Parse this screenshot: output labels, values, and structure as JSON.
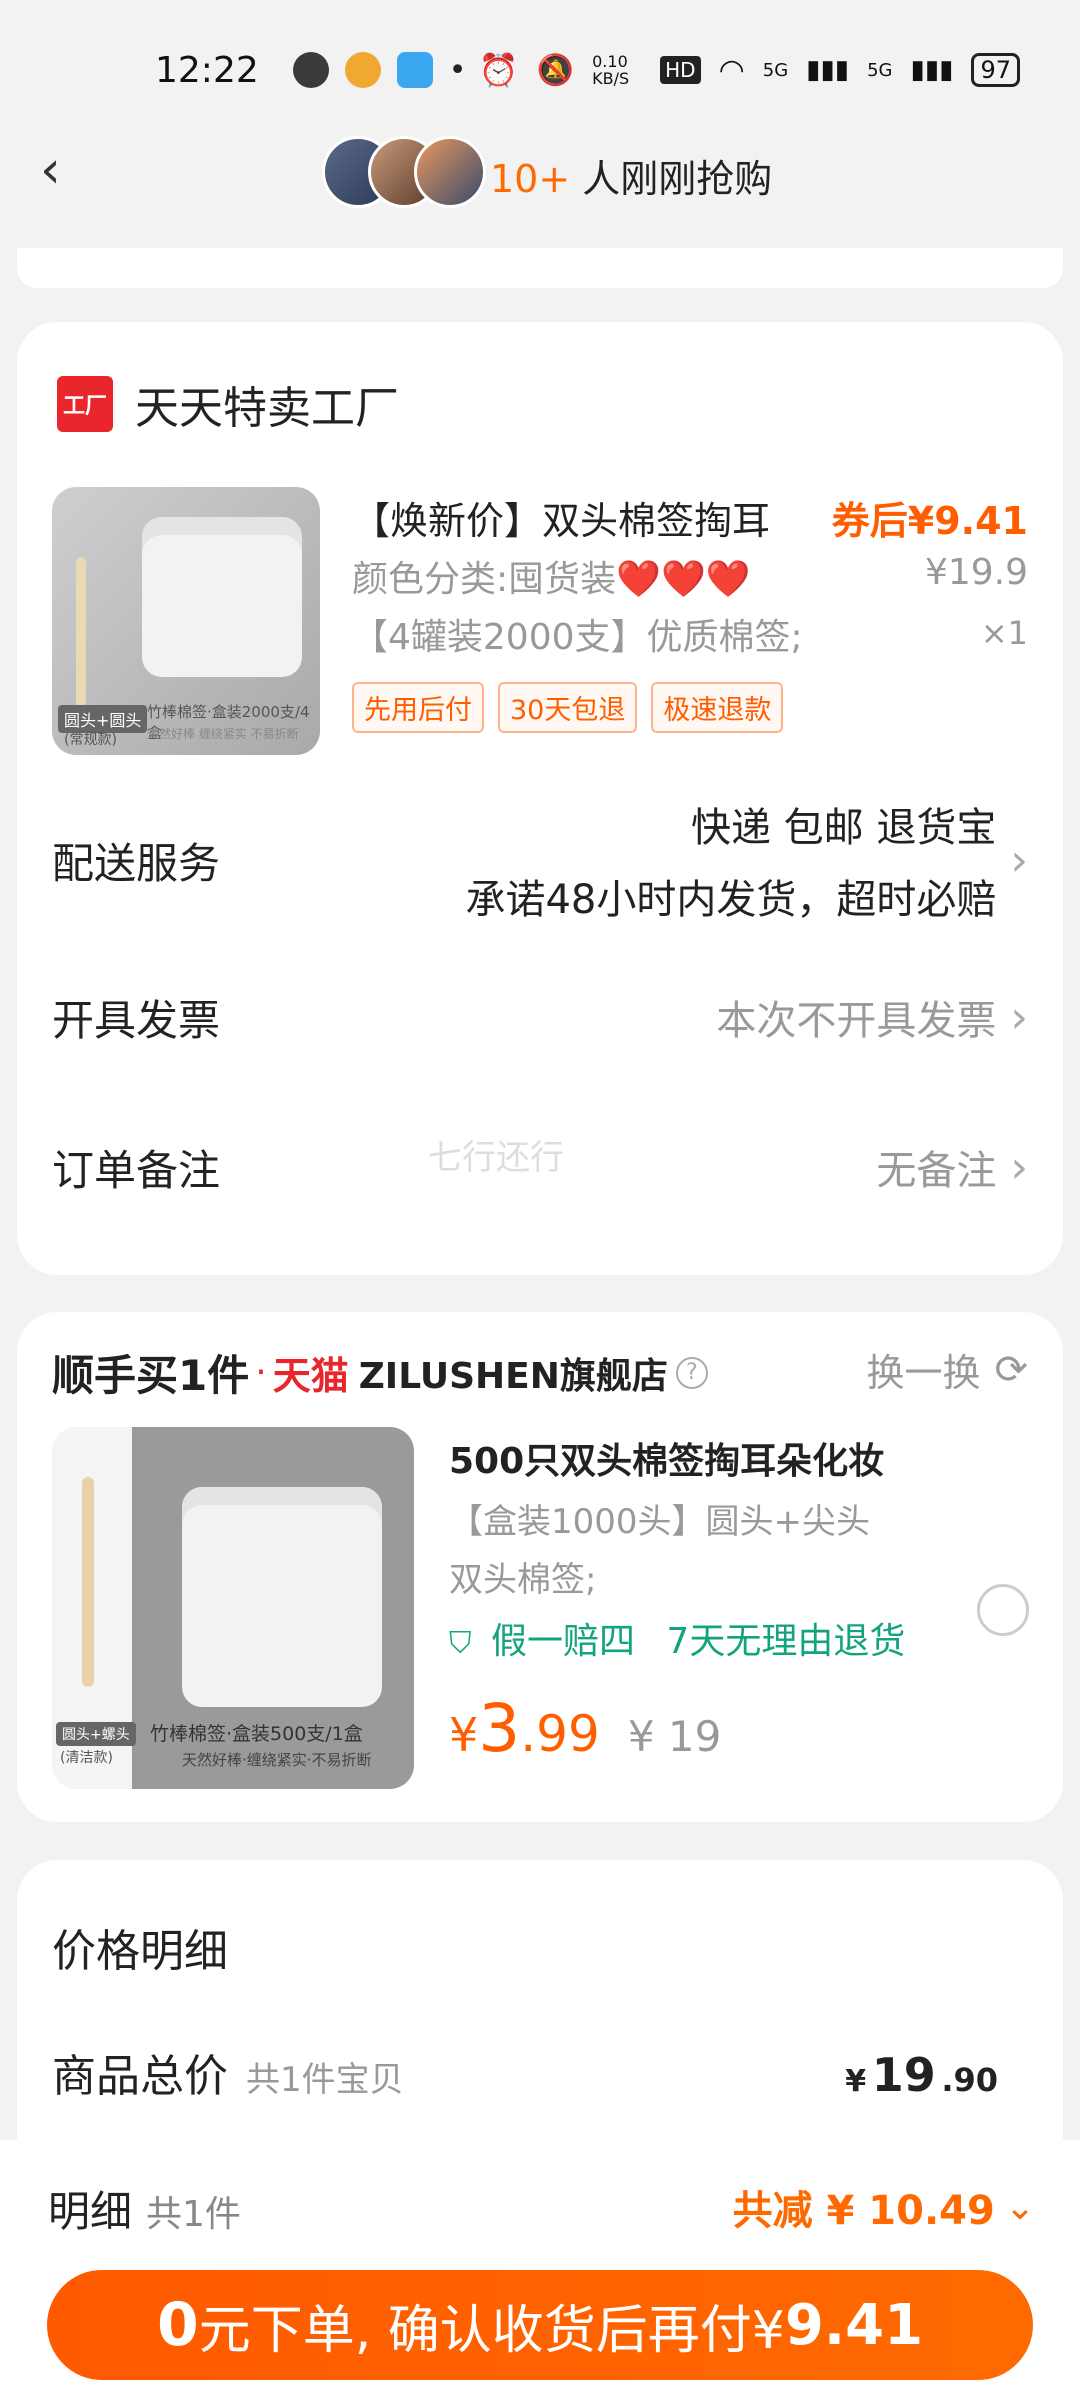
{
  "status_bar": {
    "time": "12:22",
    "network_speed": "0.10 KB/S",
    "hd": "HD",
    "signal1": "5G",
    "signal2": "5G",
    "battery": "97"
  },
  "header": {
    "recent_buyers_count": "10+",
    "recent_buyers_text": "人刚刚抢购"
  },
  "order_card": {
    "shop_logo": "工厂",
    "shop_name": "天天特卖工厂",
    "product": {
      "title": "【焕新价】双头棉签掏耳",
      "spec": "颜色分类:囤货装❤️❤️❤️",
      "desc": "【4罐装2000支】优质棉签;",
      "coupon_price": "券后¥9.41",
      "original_price": "¥19.9",
      "quantity": "×1",
      "image_tag": "圆头+圆头",
      "image_tag_sub": "(常规款)",
      "image_caption": "竹棒棉签·盒装2000支/4盒",
      "image_caption_sub": "天然好棒 缠绕紧实 不易折断",
      "badges": [
        "先用后付",
        "30天包退",
        "极速退款"
      ]
    },
    "delivery": {
      "label": "配送服务",
      "line1": "快递 包邮 退货宝",
      "line2": "承诺48小时内发货，超时必赔"
    },
    "invoice": {
      "label": "开具发票",
      "value": "本次不开具发票"
    },
    "note": {
      "label": "订单备注",
      "value": "无备注"
    }
  },
  "watermark": "七行还行",
  "addon_card": {
    "brand": "顺手买1件",
    "dot": "·",
    "store_prefix": "天猫",
    "store_name": "ZILUSHEN旗舰店",
    "help_icon": "?",
    "refresh_label": "换一换",
    "product": {
      "title": "500只双头棉签掏耳朵化妆",
      "desc1": "【盒装1000头】圆头+尖头",
      "desc2": "双头棉签;",
      "guarantee1": "假一赔四",
      "guarantee2": "7天无理由退货",
      "price_currency": "¥",
      "price_int": "3",
      "price_dec": ".99",
      "original_price": "¥ 19",
      "image_tag": "圆头+螺头",
      "image_tag_sub": "(清洁款)",
      "image_caption": "竹棒棉签·盒装500支/1盒",
      "image_caption_sub": "天然好棒·缠绕紧实·不易折断"
    }
  },
  "price_card": {
    "title": "价格明细",
    "total_label": "商品总价",
    "total_count": "共1件宝贝",
    "total_currency": "¥",
    "total_int": "19",
    "total_dec": ".90"
  },
  "bottom_bar": {
    "detail_label": "明细",
    "detail_count": "共1件",
    "discount_text": "共减 ¥ 10.49",
    "cta_zero": "0",
    "cta_text": "元下单, 确认收货后再付¥",
    "cta_amount": "9.41"
  },
  "colors": {
    "accent": "#ff6a00",
    "tmall_red": "#e8262b",
    "green": "#14a37f"
  }
}
